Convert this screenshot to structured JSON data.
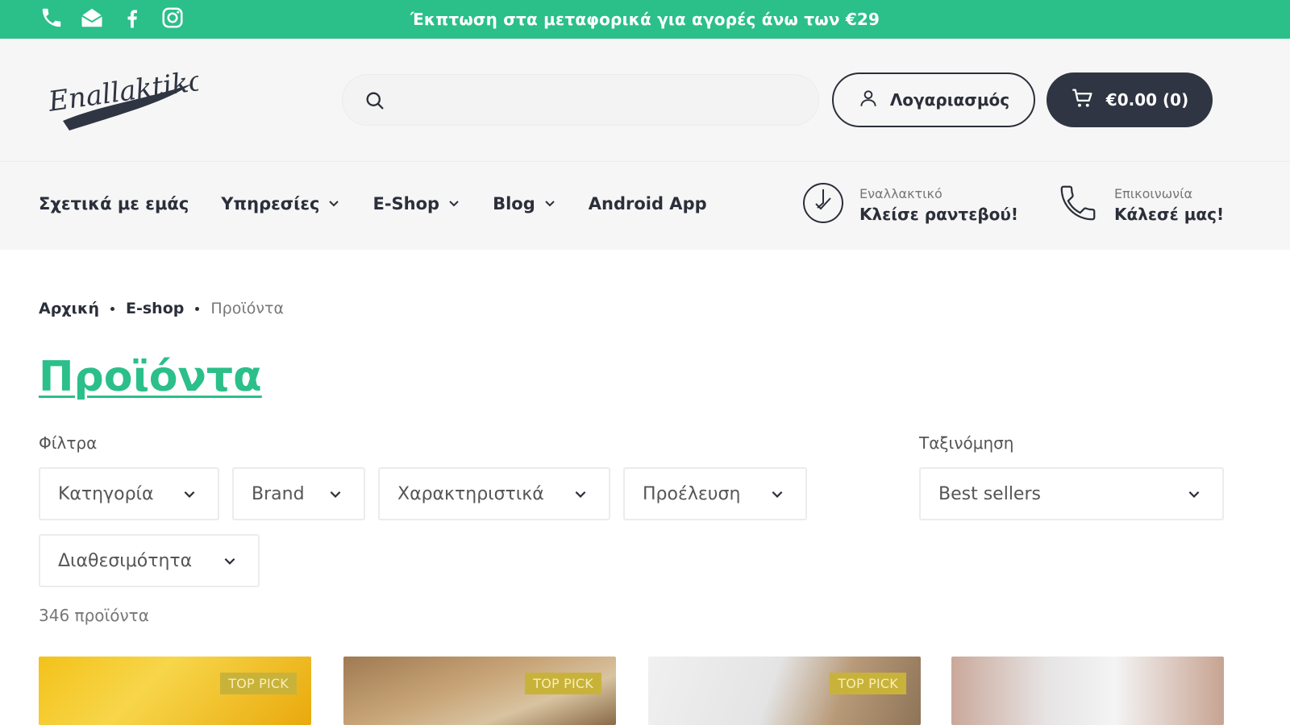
{
  "topbar": {
    "promo_text": "Έκπτωση στα μεταφορικά για αγορές άνω των €29",
    "icons": [
      "phone-icon",
      "mail-open-icon",
      "facebook-icon",
      "instagram-icon"
    ]
  },
  "header": {
    "logo_text": "Enallaktiko",
    "search": {
      "placeholder": "",
      "value": ""
    },
    "account_label": "Λογαριασμός",
    "cart_label": "€0.00 (0)"
  },
  "nav": {
    "items": [
      {
        "label": "Σχετικά με εμάς",
        "dropdown": false
      },
      {
        "label": "Υπηρεσίες",
        "dropdown": true
      },
      {
        "label": "E-Shop",
        "dropdown": true
      },
      {
        "label": "Blog",
        "dropdown": true
      },
      {
        "label": "Android App",
        "dropdown": false
      }
    ],
    "cta_booking": {
      "small": "Εναλλακτικό",
      "big": "Κλείσε ραντεβού!"
    },
    "cta_call": {
      "small": "Επικοινωνία",
      "big": "Κάλεσέ μας!"
    }
  },
  "breadcrumb": {
    "items": [
      "Αρχική",
      "E-shop"
    ],
    "current": "Προϊόντα"
  },
  "page_title": "Προϊόντα",
  "filters": {
    "label": "Φίλτρα",
    "options": [
      "Κατηγορία",
      "Brand",
      "Χαρακτηριστικά",
      "Προέλευση",
      "Διαθεσιμότητα"
    ]
  },
  "sort": {
    "label": "Ταξινόμηση",
    "selected": "Best sellers"
  },
  "product_count": "346 προϊόντα",
  "cards": [
    {
      "badge": "TOP PICK"
    },
    {
      "badge": "TOP PICK"
    },
    {
      "badge": "TOP PICK"
    },
    {
      "badge": ""
    }
  ],
  "colors": {
    "accent": "#2bbf8a",
    "dark": "#2f3542",
    "badge": "#c9b23a"
  }
}
